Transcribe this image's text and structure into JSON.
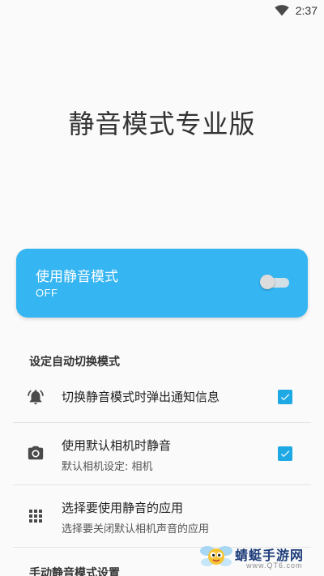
{
  "status_bar": {
    "time": "2:37",
    "icons": [
      "wifi-icon"
    ]
  },
  "app": {
    "title": "静音模式专业版"
  },
  "main_toggle": {
    "label": "使用静音模式",
    "state": "OFF",
    "enabled": false,
    "color": "#35b5f2"
  },
  "sections": {
    "auto_switch": "设定自动切换模式",
    "manual": "手动静音模式设置"
  },
  "settings": {
    "notify": {
      "title": "切换静音模式时弹出通知信息",
      "checked": true,
      "icon": "bell-icon"
    },
    "camera": {
      "title": "使用默认相机时静音",
      "subtitle": "默认相机设定: 相机",
      "checked": true,
      "icon": "camera-icon"
    },
    "apps": {
      "title": "选择要使用静音的应用",
      "subtitle": "选择要关闭默认相机声音的应用",
      "icon": "grid-apps-icon"
    }
  },
  "watermark": {
    "text": "蜻蜓手游网",
    "url": "www.QT6.com"
  },
  "colors": {
    "accent": "#35b5f2",
    "checkbox": "#1fa9e4",
    "background": "#fafafa"
  }
}
